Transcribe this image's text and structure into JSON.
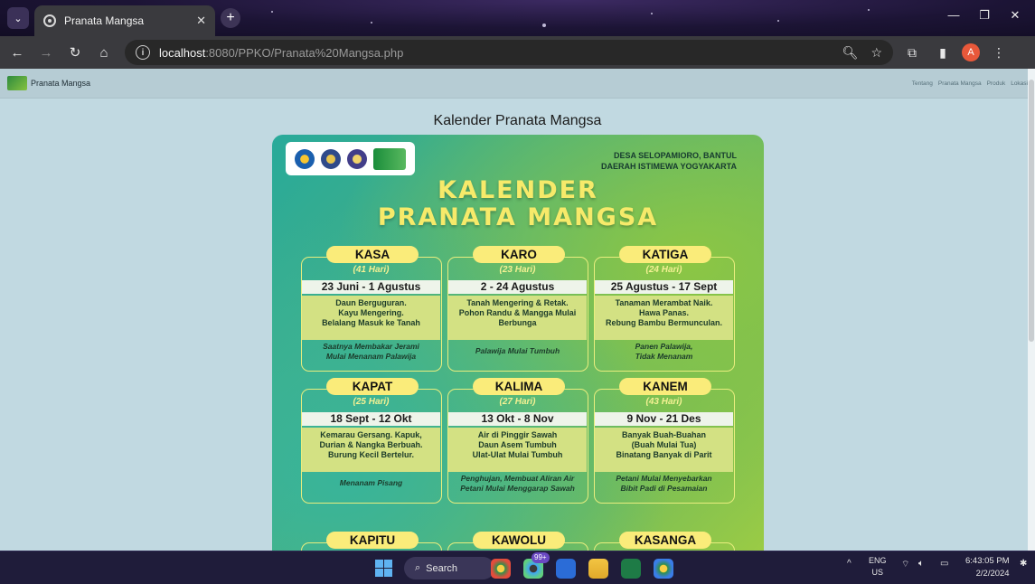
{
  "browser": {
    "tab_title": "Pranata Mangsa",
    "tab_close": "✕",
    "new_tab": "+",
    "url_host": "localhost",
    "url_path": ":8080/PPKO/Pranata%20Mangsa.php",
    "profile_initial": "A"
  },
  "site": {
    "name": "Pranata Mangsa",
    "nav": [
      "Tentang",
      "Pranata Mangsa",
      "Produk",
      "Lokasi"
    ]
  },
  "page": {
    "title": "Kalender Pranata Mangsa"
  },
  "poster": {
    "location_line1": "DESA SELOPAMIORO, BANTUL",
    "location_line2": "DAERAH ISTIMEWA YOGYAKARTA",
    "title_line1": "KALENDER",
    "title_line2": "PRANATA MANGSA",
    "cards": [
      {
        "name": "KASA",
        "days": "(41 Hari)",
        "date": "23 Juni - 1 Agustus",
        "desc": [
          "Daun Berguguran.",
          "Kayu Mengering.",
          "Belalang Masuk ke Tanah"
        ],
        "act": [
          "Saatnya Membakar Jerami",
          "Mulai Menanam Palawija"
        ]
      },
      {
        "name": "KARO",
        "days": "(23 Hari)",
        "date": "2 - 24 Agustus",
        "desc": [
          "Tanah Mengering & Retak.",
          "Pohon Randu & Mangga Mulai",
          "Berbunga"
        ],
        "act": [
          "Palawija Mulai Tumbuh"
        ]
      },
      {
        "name": "KATIGA",
        "days": "(24 Hari)",
        "date": "25 Agustus - 17 Sept",
        "desc": [
          "Tanaman Merambat Naik.",
          "Hawa Panas.",
          "Rebung Bambu Bermunculan."
        ],
        "act": [
          "Panen Palawija,",
          "Tidak Menanam"
        ]
      },
      {
        "name": "KAPAT",
        "days": "(25 Hari)",
        "date": "18 Sept - 12 Okt",
        "desc": [
          "Kemarau Gersang. Kapuk,",
          "Durian & Nangka Berbuah.",
          "Burung Kecil Bertelur."
        ],
        "act": [
          "Menanam Pisang"
        ]
      },
      {
        "name": "KALIMA",
        "days": "(27 Hari)",
        "date": "13 Okt - 8 Nov",
        "desc": [
          "Air di Pinggir Sawah",
          "Daun Asem Tumbuh",
          "Ulat-Ulat Mulai Tumbuh"
        ],
        "act": [
          "Penghujan, Membuat Aliran Air",
          "Petani Mulai Menggarap Sawah"
        ]
      },
      {
        "name": "KANEM",
        "days": "(43 Hari)",
        "date": "9 Nov - 21 Des",
        "desc": [
          "Banyak Buah-Buahan",
          "(Buah Mulai Tua)",
          "Binatang Banyak di Parit"
        ],
        "act": [
          "Petani Mulai Menyebarkan",
          "Bibit Padi di Pesamaian"
        ]
      },
      {
        "name": "KAPITU"
      },
      {
        "name": "KAWOLU"
      },
      {
        "name": "KASANGA"
      }
    ]
  },
  "taskbar": {
    "search_label": "Search",
    "badge": "99+",
    "lang_line1": "ENG",
    "lang_line2": "US",
    "time": "6:43:05 PM",
    "date": "2/2/2024"
  },
  "colors": {
    "page_bg": "#c1d9e1",
    "pill": "#faec7a",
    "title_yellow": "#f6ea6a"
  }
}
